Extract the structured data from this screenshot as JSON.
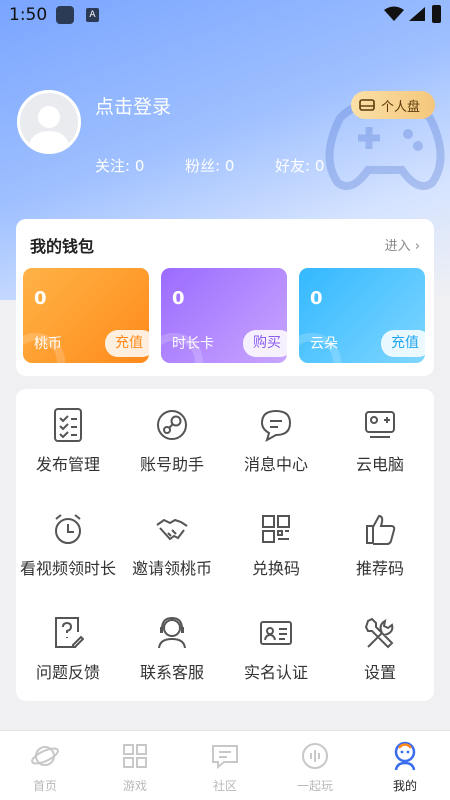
{
  "status_bar": {
    "time": "1:50",
    "notif_letter": "A"
  },
  "profile": {
    "login_prompt": "点击登录",
    "personal_disk_label": "个人盘",
    "follow": "关注: 0",
    "fans": "粉丝: 0",
    "friends": "好友: 0"
  },
  "wallet": {
    "title": "我的钱包",
    "enter_label": "进入 ›",
    "cards": [
      {
        "value": "0",
        "name": "桃币",
        "action": "充值",
        "color": "#ff8a1a"
      },
      {
        "value": "0",
        "name": "时长卡",
        "action": "购买",
        "color": "#9b6bff"
      },
      {
        "value": "0",
        "name": "云朵",
        "action": "充值",
        "color": "#33b8ff"
      }
    ]
  },
  "menu": [
    {
      "label": "发布管理",
      "icon": "checklist-icon"
    },
    {
      "label": "账号助手",
      "icon": "steam-icon"
    },
    {
      "label": "消息中心",
      "icon": "chat-bubble-icon"
    },
    {
      "label": "云电脑",
      "icon": "cloud-pc-icon"
    },
    {
      "label": "看视频领时长",
      "icon": "alarm-clock-icon"
    },
    {
      "label": "邀请领桃币",
      "icon": "handshake-icon"
    },
    {
      "label": "兑换码",
      "icon": "qr-code-icon"
    },
    {
      "label": "推荐码",
      "icon": "thumbs-up-icon"
    },
    {
      "label": "问题反馈",
      "icon": "feedback-icon"
    },
    {
      "label": "联系客服",
      "icon": "headset-icon"
    },
    {
      "label": "实名认证",
      "icon": "id-card-icon"
    },
    {
      "label": "设置",
      "icon": "tools-icon"
    }
  ],
  "tabs": [
    {
      "label": "首页",
      "icon": "planet-icon"
    },
    {
      "label": "游戏",
      "icon": "grid-icon"
    },
    {
      "label": "社区",
      "icon": "message-icon"
    },
    {
      "label": "一起玩",
      "icon": "voice-icon"
    },
    {
      "label": "我的",
      "icon": "profile-icon",
      "active": true
    }
  ],
  "colors": {
    "accent": "#7aa5ff",
    "gold": "#f4c77b",
    "active_tab": "#222222"
  }
}
